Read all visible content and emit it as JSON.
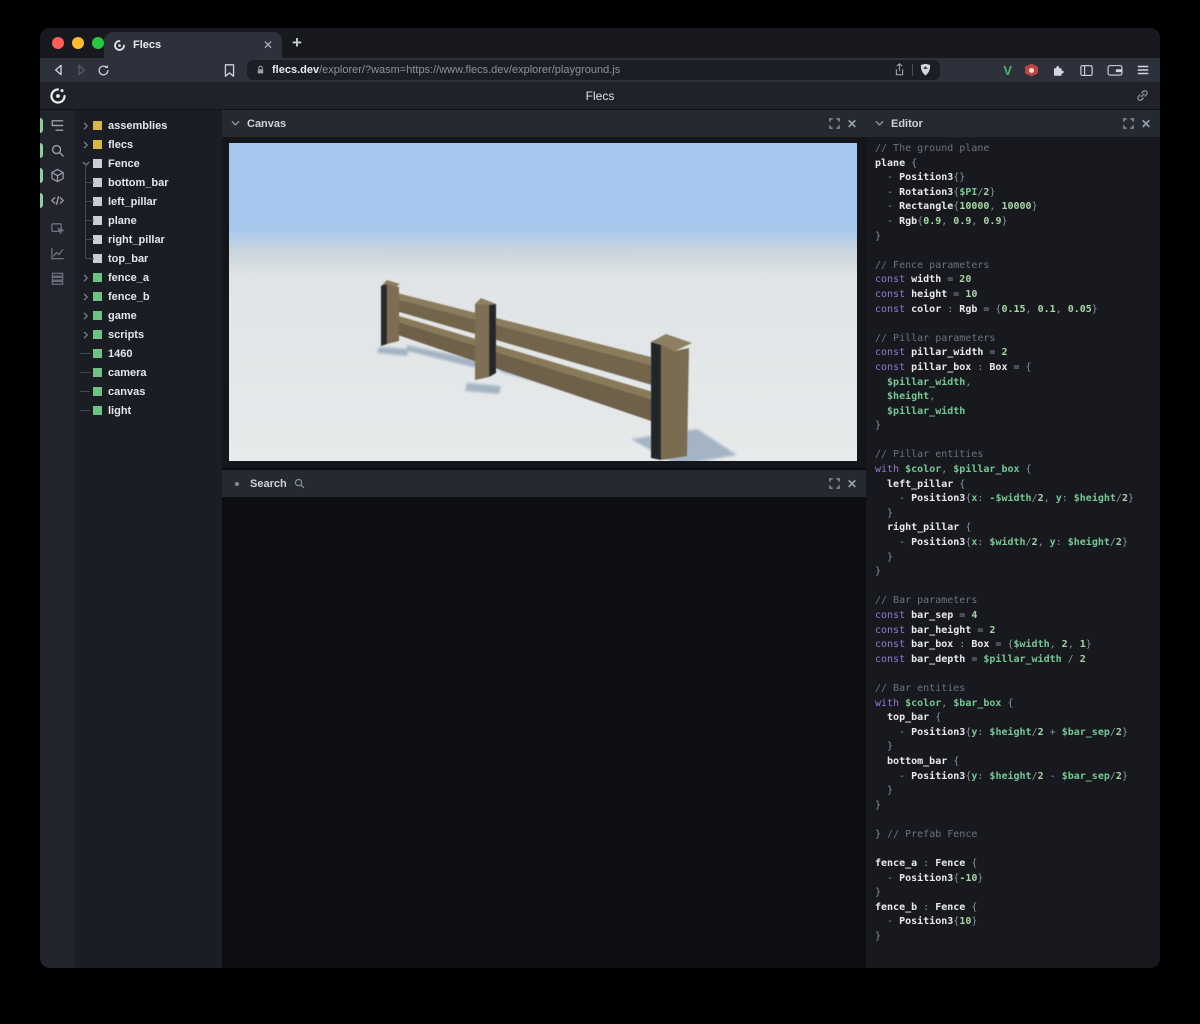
{
  "browser": {
    "tab": {
      "title": "Flecs",
      "close_label": "✕",
      "new_tab_label": "+"
    },
    "url": {
      "domain": "flecs.dev",
      "path": "/explorer/?wasm=https://www.flecs.dev/explorer/playground.js"
    },
    "toolbar_icon_names": [
      "back-icon",
      "forward-icon",
      "reload-icon",
      "bookmark-icon",
      "lock-icon",
      "share-icon",
      "brave-shield-icon",
      "v-extension-icon",
      "adblock-extension-icon",
      "extensions-puzzle-icon",
      "sidebar-icon",
      "wallet-icon",
      "menu-icon"
    ]
  },
  "app": {
    "title": "Flecs",
    "logo": "flecs-logo",
    "link_icon": "link-icon"
  },
  "nav": {
    "items": [
      {
        "name": "entity-tree",
        "active": true
      },
      {
        "name": "query-search",
        "active": true
      },
      {
        "name": "canvas-3d",
        "active": true
      },
      {
        "name": "code-editor",
        "active": true
      },
      {
        "name": "inspector",
        "active": false
      },
      {
        "name": "statistics",
        "active": false
      },
      {
        "name": "logs",
        "active": false
      }
    ]
  },
  "tree": {
    "items": [
      {
        "label": "assemblies",
        "color": "yellow",
        "kind": "collapsed"
      },
      {
        "label": "flecs",
        "color": "yellow",
        "kind": "collapsed"
      },
      {
        "label": "Fence",
        "color": "gray",
        "kind": "expanded"
      },
      {
        "label": "bottom_bar",
        "color": "gray",
        "kind": "child"
      },
      {
        "label": "left_pillar",
        "color": "gray",
        "kind": "child"
      },
      {
        "label": "plane",
        "color": "gray",
        "kind": "child"
      },
      {
        "label": "right_pillar",
        "color": "gray",
        "kind": "child"
      },
      {
        "label": "top_bar",
        "color": "gray",
        "kind": "child"
      },
      {
        "label": "fence_a",
        "color": "green",
        "kind": "collapsed"
      },
      {
        "label": "fence_b",
        "color": "green",
        "kind": "collapsed"
      },
      {
        "label": "game",
        "color": "green",
        "kind": "collapsed"
      },
      {
        "label": "scripts",
        "color": "green",
        "kind": "collapsed"
      },
      {
        "label": "1460",
        "color": "green",
        "kind": "leaf"
      },
      {
        "label": "camera",
        "color": "green",
        "kind": "leaf"
      },
      {
        "label": "canvas",
        "color": "green",
        "kind": "leaf"
      },
      {
        "label": "light",
        "color": "green",
        "kind": "leaf"
      }
    ]
  },
  "panels": {
    "canvas": {
      "title": "Canvas"
    },
    "search": {
      "title": "Search"
    },
    "editor": {
      "title": "Editor"
    }
  },
  "scene": {
    "colors": {
      "sky": "#a6c8ee",
      "ground": "#e6e9ea",
      "wood_top": "#8d7f60",
      "wood_front": "#796b50",
      "wood_dark": "#26282c",
      "shadow": "#8fa3b8"
    }
  },
  "code": {
    "lines": [
      [
        [
          "c",
          "// The ground plane"
        ]
      ],
      [
        [
          "i",
          "plane"
        ],
        [
          "p",
          " {"
        ]
      ],
      [
        [
          "p",
          "  - "
        ],
        [
          "i",
          "Position3"
        ],
        [
          "p",
          "{}"
        ]
      ],
      [
        [
          "p",
          "  - "
        ],
        [
          "i",
          "Rotation3"
        ],
        [
          "p",
          "{"
        ],
        [
          "v",
          "$PI"
        ],
        [
          "p",
          "/"
        ],
        [
          "n",
          "2"
        ],
        [
          "p",
          "}"
        ]
      ],
      [
        [
          "p",
          "  - "
        ],
        [
          "i",
          "Rectangle"
        ],
        [
          "p",
          "{"
        ],
        [
          "n",
          "10000"
        ],
        [
          "p",
          ", "
        ],
        [
          "n",
          "10000"
        ],
        [
          "p",
          "}"
        ]
      ],
      [
        [
          "p",
          "  - "
        ],
        [
          "i",
          "Rgb"
        ],
        [
          "p",
          "{"
        ],
        [
          "n",
          "0.9"
        ],
        [
          "p",
          ", "
        ],
        [
          "n",
          "0.9"
        ],
        [
          "p",
          ", "
        ],
        [
          "n",
          "0.9"
        ],
        [
          "p",
          "}"
        ]
      ],
      [
        [
          "p",
          "}"
        ]
      ],
      [],
      [
        [
          "c",
          "// Fence parameters"
        ]
      ],
      [
        [
          "k",
          "const "
        ],
        [
          "i",
          "width"
        ],
        [
          "p",
          " = "
        ],
        [
          "n",
          "20"
        ]
      ],
      [
        [
          "k",
          "const "
        ],
        [
          "i",
          "height"
        ],
        [
          "p",
          " = "
        ],
        [
          "n",
          "10"
        ]
      ],
      [
        [
          "k",
          "const "
        ],
        [
          "i",
          "color"
        ],
        [
          "p",
          " : "
        ],
        [
          "i",
          "Rgb"
        ],
        [
          "p",
          " = {"
        ],
        [
          "n",
          "0.15"
        ],
        [
          "p",
          ", "
        ],
        [
          "n",
          "0.1"
        ],
        [
          "p",
          ", "
        ],
        [
          "n",
          "0.05"
        ],
        [
          "p",
          "}"
        ]
      ],
      [],
      [
        [
          "c",
          "// Pillar parameters"
        ]
      ],
      [
        [
          "k",
          "const "
        ],
        [
          "i",
          "pillar_width"
        ],
        [
          "p",
          " = "
        ],
        [
          "n",
          "2"
        ]
      ],
      [
        [
          "k",
          "const "
        ],
        [
          "i",
          "pillar_box"
        ],
        [
          "p",
          " : "
        ],
        [
          "i",
          "Box"
        ],
        [
          "p",
          " = {"
        ]
      ],
      [
        [
          "v",
          "  $pillar_width"
        ],
        [
          "p",
          ","
        ]
      ],
      [
        [
          "v",
          "  $height"
        ],
        [
          "p",
          ","
        ]
      ],
      [
        [
          "v",
          "  $pillar_width"
        ]
      ],
      [
        [
          "p",
          "}"
        ]
      ],
      [],
      [
        [
          "c",
          "// Pillar entities"
        ]
      ],
      [
        [
          "k",
          "with "
        ],
        [
          "v",
          "$color"
        ],
        [
          "p",
          ", "
        ],
        [
          "v",
          "$pillar_box"
        ],
        [
          "p",
          " {"
        ]
      ],
      [
        [
          "i",
          "  left_pillar"
        ],
        [
          "p",
          " {"
        ]
      ],
      [
        [
          "p",
          "    - "
        ],
        [
          "i",
          "Position3"
        ],
        [
          "p",
          "{"
        ],
        [
          "v",
          "x"
        ],
        [
          "p",
          ": "
        ],
        [
          "v",
          "-$width"
        ],
        [
          "p",
          "/"
        ],
        [
          "n",
          "2"
        ],
        [
          "p",
          ", "
        ],
        [
          "v",
          "y"
        ],
        [
          "p",
          ": "
        ],
        [
          "v",
          "$height"
        ],
        [
          "p",
          "/"
        ],
        [
          "n",
          "2"
        ],
        [
          "p",
          "}"
        ]
      ],
      [
        [
          "p",
          "  }"
        ]
      ],
      [
        [
          "i",
          "  right_pillar"
        ],
        [
          "p",
          " {"
        ]
      ],
      [
        [
          "p",
          "    - "
        ],
        [
          "i",
          "Position3"
        ],
        [
          "p",
          "{"
        ],
        [
          "v",
          "x"
        ],
        [
          "p",
          ": "
        ],
        [
          "v",
          "$width"
        ],
        [
          "p",
          "/"
        ],
        [
          "n",
          "2"
        ],
        [
          "p",
          ", "
        ],
        [
          "v",
          "y"
        ],
        [
          "p",
          ": "
        ],
        [
          "v",
          "$height"
        ],
        [
          "p",
          "/"
        ],
        [
          "n",
          "2"
        ],
        [
          "p",
          "}"
        ]
      ],
      [
        [
          "p",
          "  }"
        ]
      ],
      [
        [
          "p",
          "}"
        ]
      ],
      [],
      [
        [
          "c",
          "// Bar parameters"
        ]
      ],
      [
        [
          "k",
          "const "
        ],
        [
          "i",
          "bar_sep"
        ],
        [
          "p",
          " = "
        ],
        [
          "n",
          "4"
        ]
      ],
      [
        [
          "k",
          "const "
        ],
        [
          "i",
          "bar_height"
        ],
        [
          "p",
          " = "
        ],
        [
          "n",
          "2"
        ]
      ],
      [
        [
          "k",
          "const "
        ],
        [
          "i",
          "bar_box"
        ],
        [
          "p",
          " : "
        ],
        [
          "i",
          "Box"
        ],
        [
          "p",
          " = {"
        ],
        [
          "v",
          "$width"
        ],
        [
          "p",
          ", "
        ],
        [
          "n",
          "2"
        ],
        [
          "p",
          ", "
        ],
        [
          "n",
          "1"
        ],
        [
          "p",
          "}"
        ]
      ],
      [
        [
          "k",
          "const "
        ],
        [
          "i",
          "bar_depth"
        ],
        [
          "p",
          " = "
        ],
        [
          "v",
          "$pillar_width"
        ],
        [
          "p",
          " / "
        ],
        [
          "n",
          "2"
        ]
      ],
      [],
      [
        [
          "c",
          "// Bar entities"
        ]
      ],
      [
        [
          "k",
          "with "
        ],
        [
          "v",
          "$color"
        ],
        [
          "p",
          ", "
        ],
        [
          "v",
          "$bar_box"
        ],
        [
          "p",
          " {"
        ]
      ],
      [
        [
          "i",
          "  top_bar"
        ],
        [
          "p",
          " {"
        ]
      ],
      [
        [
          "p",
          "    - "
        ],
        [
          "i",
          "Position3"
        ],
        [
          "p",
          "{"
        ],
        [
          "v",
          "y"
        ],
        [
          "p",
          ": "
        ],
        [
          "v",
          "$height"
        ],
        [
          "p",
          "/"
        ],
        [
          "n",
          "2"
        ],
        [
          "p",
          " + "
        ],
        [
          "v",
          "$bar_sep"
        ],
        [
          "p",
          "/"
        ],
        [
          "n",
          "2"
        ],
        [
          "p",
          "}"
        ]
      ],
      [
        [
          "p",
          "  }"
        ]
      ],
      [
        [
          "i",
          "  bottom_bar"
        ],
        [
          "p",
          " {"
        ]
      ],
      [
        [
          "p",
          "    - "
        ],
        [
          "i",
          "Position3"
        ],
        [
          "p",
          "{"
        ],
        [
          "v",
          "y"
        ],
        [
          "p",
          ": "
        ],
        [
          "v",
          "$height"
        ],
        [
          "p",
          "/"
        ],
        [
          "n",
          "2"
        ],
        [
          "p",
          " - "
        ],
        [
          "v",
          "$bar_sep"
        ],
        [
          "p",
          "/"
        ],
        [
          "n",
          "2"
        ],
        [
          "p",
          "}"
        ]
      ],
      [
        [
          "p",
          "  }"
        ]
      ],
      [
        [
          "p",
          "}"
        ]
      ],
      [],
      [
        [
          "p",
          "} "
        ],
        [
          "c",
          "// Prefab Fence"
        ]
      ],
      [],
      [
        [
          "i",
          "fence_a"
        ],
        [
          "p",
          " : "
        ],
        [
          "i",
          "Fence"
        ],
        [
          "p",
          " {"
        ]
      ],
      [
        [
          "p",
          "  - "
        ],
        [
          "i",
          "Position3"
        ],
        [
          "p",
          "{"
        ],
        [
          "n",
          "-10"
        ],
        [
          "p",
          "}"
        ]
      ],
      [
        [
          "p",
          "}"
        ]
      ],
      [
        [
          "i",
          "fence_b"
        ],
        [
          "p",
          " : "
        ],
        [
          "i",
          "Fence"
        ],
        [
          "p",
          " {"
        ]
      ],
      [
        [
          "p",
          "  - "
        ],
        [
          "i",
          "Position3"
        ],
        [
          "p",
          "{"
        ],
        [
          "n",
          "10"
        ],
        [
          "p",
          "}"
        ]
      ],
      [
        [
          "p",
          "}"
        ]
      ]
    ]
  }
}
